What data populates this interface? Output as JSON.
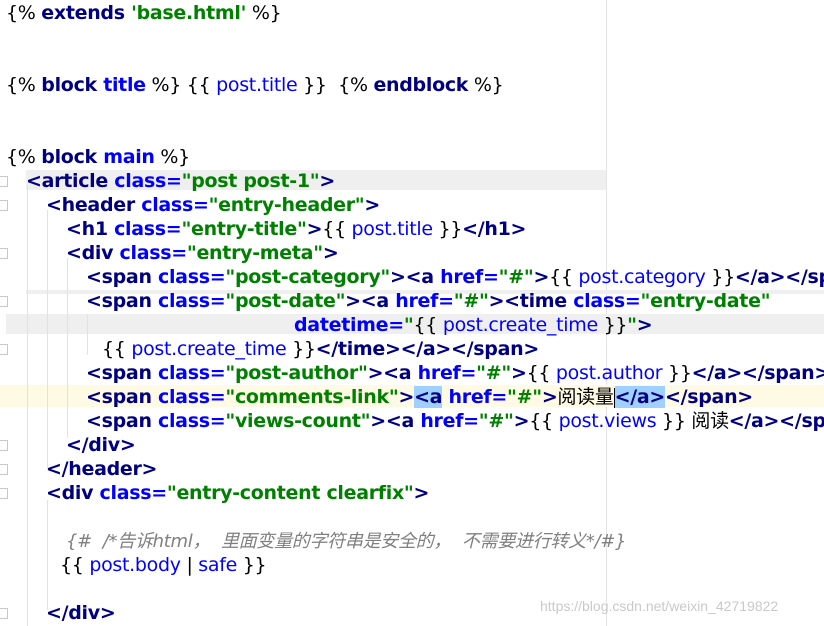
{
  "lines": [
    {
      "parts": [
        [
          "tpl",
          "{% "
        ],
        [
          "kw",
          "extends"
        ],
        [
          "str",
          " 'base.html'"
        ],
        [
          "tpl",
          " %}"
        ]
      ]
    },
    {
      "parts": []
    },
    {
      "parts": [
        [
          "tpl",
          "{% "
        ],
        [
          "kw",
          "block"
        ],
        [
          "attr",
          " title"
        ],
        [
          "tpl",
          " %} {{ "
        ],
        [
          "var",
          "post.title"
        ],
        [
          "tpl",
          " }}  {% "
        ],
        [
          "kw",
          "endblock"
        ],
        [
          "tpl",
          " %}"
        ]
      ]
    },
    {
      "parts": []
    },
    {
      "parts": [
        [
          "tpl",
          "{% "
        ],
        [
          "kw",
          "block"
        ],
        [
          "attr",
          " main"
        ],
        [
          "tpl",
          " %}"
        ]
      ]
    },
    {
      "parts": [
        [
          "tag",
          "<article"
        ],
        [
          "attr",
          " class="
        ],
        [
          "str",
          "\"post post-1\""
        ],
        [
          "tag",
          ">"
        ]
      ]
    },
    {
      "parts": [
        [
          "tag",
          "<header"
        ],
        [
          "attr",
          " class="
        ],
        [
          "str",
          "\"entry-header\""
        ],
        [
          "tag",
          ">"
        ]
      ]
    },
    {
      "parts": [
        [
          "tag",
          "<h1"
        ],
        [
          "attr",
          " class="
        ],
        [
          "str",
          "\"entry-title\""
        ],
        [
          "tag",
          ">"
        ],
        [
          "tpl",
          "{{ "
        ],
        [
          "var",
          "post.title"
        ],
        [
          "tpl",
          " }}"
        ],
        [
          "tag",
          "</h1>"
        ]
      ]
    },
    {
      "parts": [
        [
          "tag",
          "<div"
        ],
        [
          "attr",
          " class="
        ],
        [
          "str",
          "\"entry-meta\""
        ],
        [
          "tag",
          ">"
        ]
      ]
    },
    {
      "parts": [
        [
          "tag",
          "<span"
        ],
        [
          "attr",
          " class="
        ],
        [
          "str",
          "\"post-category\""
        ],
        [
          "tag",
          "><a"
        ],
        [
          "attr",
          " href="
        ],
        [
          "str",
          "\"#\""
        ],
        [
          "tag",
          ">"
        ],
        [
          "tpl",
          "{{ "
        ],
        [
          "var",
          "post.category"
        ],
        [
          "tpl",
          " }}"
        ],
        [
          "tag",
          "</a></span>"
        ]
      ]
    },
    {
      "parts": [
        [
          "tag",
          "<span"
        ],
        [
          "attr",
          " class="
        ],
        [
          "str",
          "\"post-date\""
        ],
        [
          "tag",
          "><a"
        ],
        [
          "attr",
          " href="
        ],
        [
          "str",
          "\"#\""
        ],
        [
          "tag",
          "><time"
        ],
        [
          "attr",
          " class="
        ],
        [
          "str",
          "\"entry-date\""
        ]
      ]
    },
    {
      "parts": [
        [
          "attr",
          "datetime="
        ],
        [
          "str",
          "\""
        ],
        [
          "tpl",
          "{{ "
        ],
        [
          "var",
          "post.create_time"
        ],
        [
          "tpl",
          " }}"
        ],
        [
          "str",
          "\""
        ],
        [
          "tag",
          ">"
        ]
      ]
    },
    {
      "parts": [
        [
          "tpl",
          "{{ "
        ],
        [
          "var",
          "post.create_time"
        ],
        [
          "tpl",
          " }}"
        ],
        [
          "tag",
          "</time></a></span>"
        ]
      ]
    },
    {
      "parts": [
        [
          "tag",
          "<span"
        ],
        [
          "attr",
          " class="
        ],
        [
          "str",
          "\"post-author\""
        ],
        [
          "tag",
          "><a"
        ],
        [
          "attr",
          " href="
        ],
        [
          "str",
          "\"#\""
        ],
        [
          "tag",
          ">"
        ],
        [
          "tpl",
          "{{ "
        ],
        [
          "var",
          "post.author"
        ],
        [
          "tpl",
          " }}"
        ],
        [
          "tag",
          "</a></span>"
        ]
      ]
    },
    {
      "parts": [
        [
          "tag",
          "<span"
        ],
        [
          "attr",
          " class="
        ],
        [
          "str",
          "\"comments-link\""
        ],
        [
          "tag",
          ">"
        ],
        [
          "match",
          "<a"
        ],
        [
          "attr",
          " href="
        ],
        [
          "str",
          "\"#\""
        ],
        [
          "tag",
          ">"
        ],
        [
          "cjk",
          "阅读量"
        ],
        [
          "caret",
          ""
        ],
        [
          "match",
          "</a>"
        ],
        [
          "tag",
          "</span>"
        ]
      ]
    },
    {
      "parts": [
        [
          "tag",
          "<span"
        ],
        [
          "attr",
          " class="
        ],
        [
          "str",
          "\"views-count\""
        ],
        [
          "tag",
          "><a"
        ],
        [
          "attr",
          " href="
        ],
        [
          "str",
          "\"#\""
        ],
        [
          "tag",
          ">"
        ],
        [
          "tpl",
          "{{ "
        ],
        [
          "var",
          "post.views"
        ],
        [
          "tpl",
          " }} "
        ],
        [
          "cjk",
          "阅读"
        ],
        [
          "tag",
          "</a></span>"
        ]
      ]
    },
    {
      "parts": [
        [
          "tag",
          "</div>"
        ]
      ]
    },
    {
      "parts": [
        [
          "tag",
          "</header>"
        ]
      ]
    },
    {
      "parts": [
        [
          "tag",
          "<div"
        ],
        [
          "attr",
          " class="
        ],
        [
          "str",
          "\"entry-content clearfix\""
        ],
        [
          "tag",
          ">"
        ]
      ]
    },
    {
      "parts": []
    },
    {
      "parts": [
        [
          "cmt",
          "{#  /*告诉html，  里面变量的字符串是安全的，  不需要进行转义*/#}"
        ]
      ]
    },
    {
      "parts": [
        [
          "tpl",
          "{{ "
        ],
        [
          "var",
          "post.body"
        ],
        [
          "tpl",
          " | "
        ],
        [
          "var",
          "safe"
        ],
        [
          "tpl",
          " }}"
        ]
      ]
    },
    {
      "parts": []
    },
    {
      "parts": [
        [
          "tag",
          "</div>"
        ]
      ]
    }
  ],
  "watermark": "https://blog.csdn.net/weixin_42719822"
}
